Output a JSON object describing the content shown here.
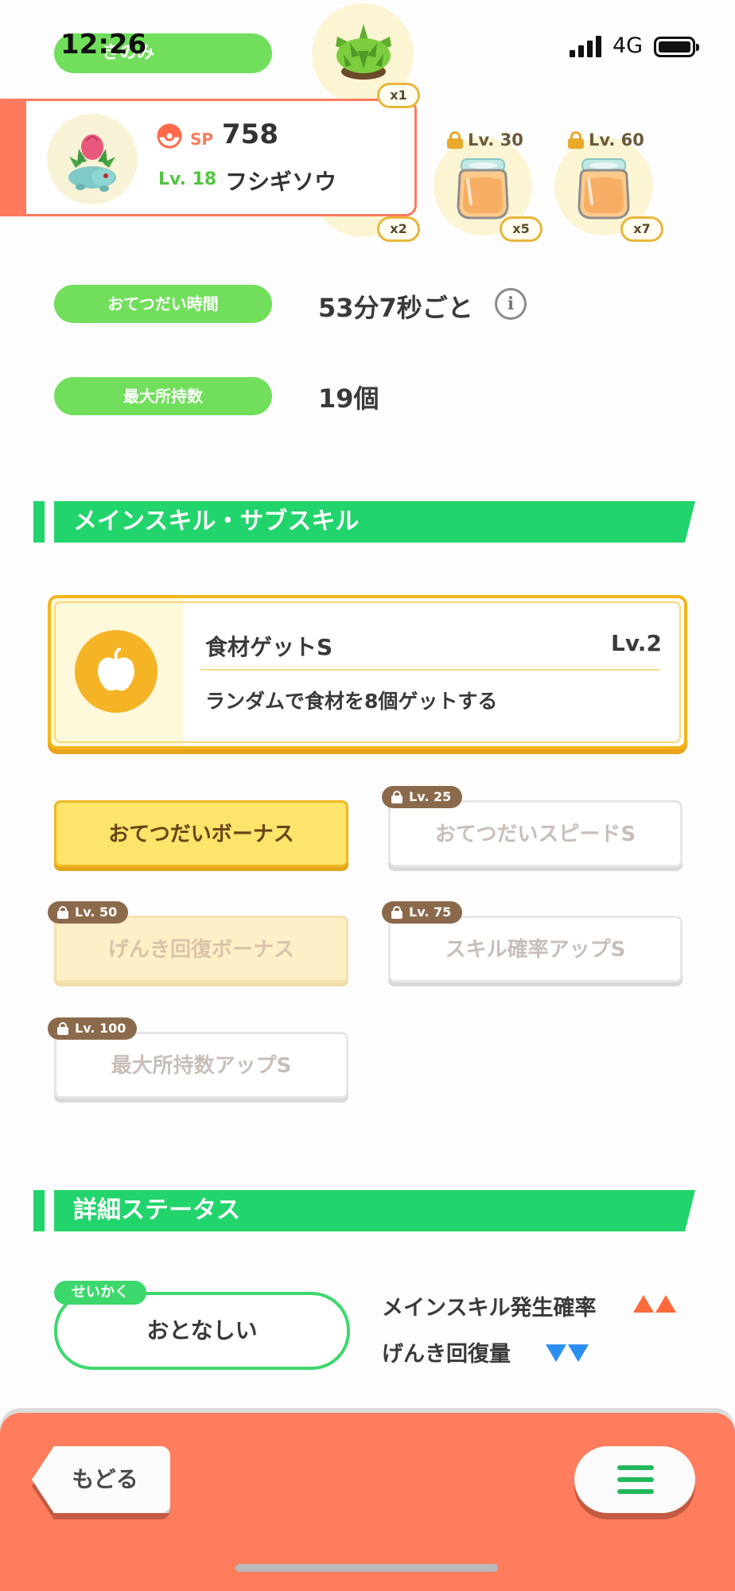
{
  "status_bar": {
    "time": "12:26",
    "network": "4G"
  },
  "ingredients": {
    "top_label": "きのみ",
    "multipliers": [
      "x1",
      "x2",
      "x5",
      "x7"
    ],
    "lock_levels": [
      "Lv. 30",
      "Lv. 60"
    ],
    "icons": [
      "shrub-icon",
      "jar-icon",
      "jar-icon"
    ]
  },
  "pokemon": {
    "sp_label": "SP",
    "sp_value": "758",
    "level": "Lv. 18",
    "name": "フシギソウ"
  },
  "info": {
    "help_time_label": "おてつだい時間",
    "help_time_value": "53分7秒ごと",
    "info_glyph": "i",
    "max_carry_label": "最大所持数",
    "max_carry_value": "19個"
  },
  "skills_section": {
    "title": "メインスキル・サブスキル",
    "main_skill": {
      "name": "食材ゲットS",
      "level": "Lv.2",
      "description": "ランダムで食材を8個ゲットする",
      "icon": "apple-icon"
    },
    "sub_skills": [
      {
        "label": "おてつだいボーナス",
        "lock": ""
      },
      {
        "label": "おてつだいスピードS",
        "lock": "Lv. 25"
      },
      {
        "label": "げんき回復ボーナス",
        "lock": "Lv. 50"
      },
      {
        "label": "スキル確率アップS",
        "lock": "Lv. 75"
      },
      {
        "label": "最大所持数アップS",
        "lock": "Lv. 100"
      }
    ]
  },
  "details_section": {
    "title": "詳細ステータス",
    "nature_tag": "せいかく",
    "nature": "おとなしい",
    "up_effect": "メインスキル発生確率",
    "down_effect": "げんき回復量",
    "colors": {
      "up": "#ff6a3c",
      "down": "#2b8ff0"
    }
  },
  "bottom_bar": {
    "back_label": "もどる",
    "menu_icon": "hamburger-menu-icon"
  },
  "colors": {
    "accent_green": "#22d46c",
    "label_green": "#71df5c",
    "card_orange": "#ff7a5c",
    "skill_yellow": "#f2b51c"
  }
}
